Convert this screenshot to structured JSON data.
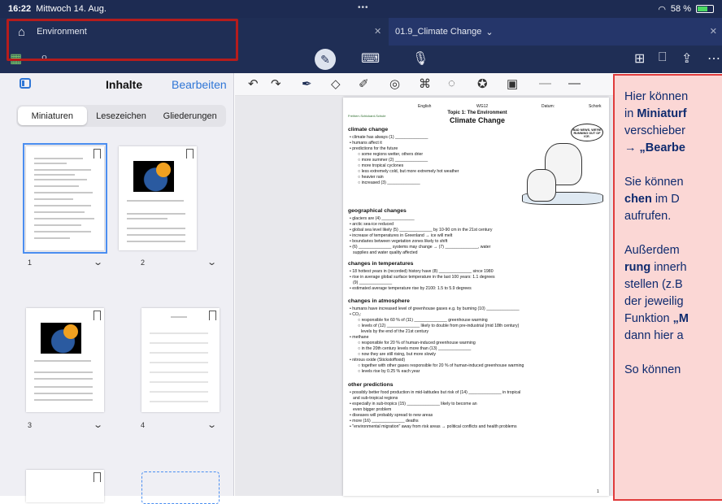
{
  "status": {
    "time": "16:22",
    "date": "Mittwoch 14. Aug.",
    "battery": "58 %",
    "battery_level": 0.58
  },
  "tabs": {
    "left_label": "Environment",
    "right_label": "01.9_Climate Change",
    "right_caret": "⌄"
  },
  "sidebar": {
    "title": "Inhalte",
    "edit_label": "Bearbeiten",
    "segments": [
      "Miniaturen",
      "Lesezeichen",
      "Gliederungen"
    ],
    "active_segment": "Miniaturen",
    "thumbs": [
      {
        "num": "1"
      },
      {
        "num": "2"
      },
      {
        "num": "3"
      },
      {
        "num": "4"
      }
    ]
  },
  "page": {
    "header": {
      "lang": "English",
      "grade": "WG12",
      "date_label": "Datum:",
      "school": "Schork"
    },
    "logo_text": "Freiherr-Schickard-Schule",
    "topic": "Topic 1: The Environment",
    "title": "Climate Change",
    "cartoon_text": "BAD NEWS. WE'RE RUNNING OUT OF ICE.",
    "sections": [
      {
        "heading": "climate change",
        "lines": [
          "climate has always (1) ______________",
          "humans affect it",
          "predictions for the future",
          "some regions wetter, others drier",
          "more summer (2) ______________",
          "more tropical cyclones",
          "less extremely cold, but more extremely hot weather",
          "heavier rain",
          "increased (3) ______________"
        ]
      },
      {
        "heading": "geographical changes",
        "lines": [
          "glaciers are (4) ______________",
          "arctic sea-ice reduced",
          "global sea level likely (5) ______________ by 10-90 cm in the 21st century",
          "increase of temperatures in Greenland → ice will melt",
          "boundaries between vegetation zones likely to shift",
          "(6) ______________ systems may change → (7) ______________, water",
          "supplies and water quality affected"
        ]
      },
      {
        "heading": "changes in temperatures",
        "lines": [
          "18 hottest years in (recorded) history have (8) ______________ since 1980",
          "rise in average global surface temperature in the last 100 years: 1.1 degrees",
          "(9) ______________",
          "estimated average temperature rise by 2100: 1.5 to 5.9 degrees"
        ]
      },
      {
        "heading": "changes in atmosphere",
        "lines": [
          "humans have increased level of greenhouse gases e.g. by burning (10) ______________",
          "CO₂:",
          "responsible for 60 % of (11) ______________ greenhouse warming",
          "levels of (12) ______________ likely to double from pre-industrial (mid 18th century)",
          "levels by the end of the 21st century",
          "methane",
          "responsible for 20 % of human-induced greenhouse warming",
          "in the 20th century levels more than (13) ______________",
          "now they are still rising, but more slowly",
          "nitrous oxide (Stickstoffoxid)",
          "together with other gases responsible for 20 % of human-induced greenhouse warming",
          "levels rise by 0.25 % each year"
        ]
      },
      {
        "heading": "other predictions",
        "lines": [
          "possibly better food production in mid-latitudes but risk of (14) ______________ in tropical",
          "and sub-tropical regions",
          "especially in sub-tropics (15) ______________ likely to become an",
          "even bigger problem",
          "diseases will probably spread to new areas",
          "more (16) ______________ deaths",
          "\"environmental migration\" away from risk areas → political conflicts and health problems"
        ]
      }
    ],
    "page_number": "1"
  },
  "overlay": {
    "p1_l1": "Hier können",
    "p1_l2_pre": "in ",
    "p1_l2_bold": "Miniaturf",
    "p1_l3": "verschieber",
    "p1_l4": "→ „Bearbe",
    "p2_l1": "Sie können",
    "p2_l2_bold": "chen",
    "p2_l2_rest": " im D",
    "p2_l3": "aufrufen.",
    "p3_l1": "Außerdem",
    "p3_l2_bold": "rung",
    "p3_l2_rest": " innerh",
    "p3_l3": "stellen (z.B",
    "p3_l4": "der jeweilig",
    "p3_l5_pre": "Funktion ",
    "p3_l5_bold": "„M",
    "p3_l6": "dann hier a",
    "p4_l1": "So können"
  }
}
